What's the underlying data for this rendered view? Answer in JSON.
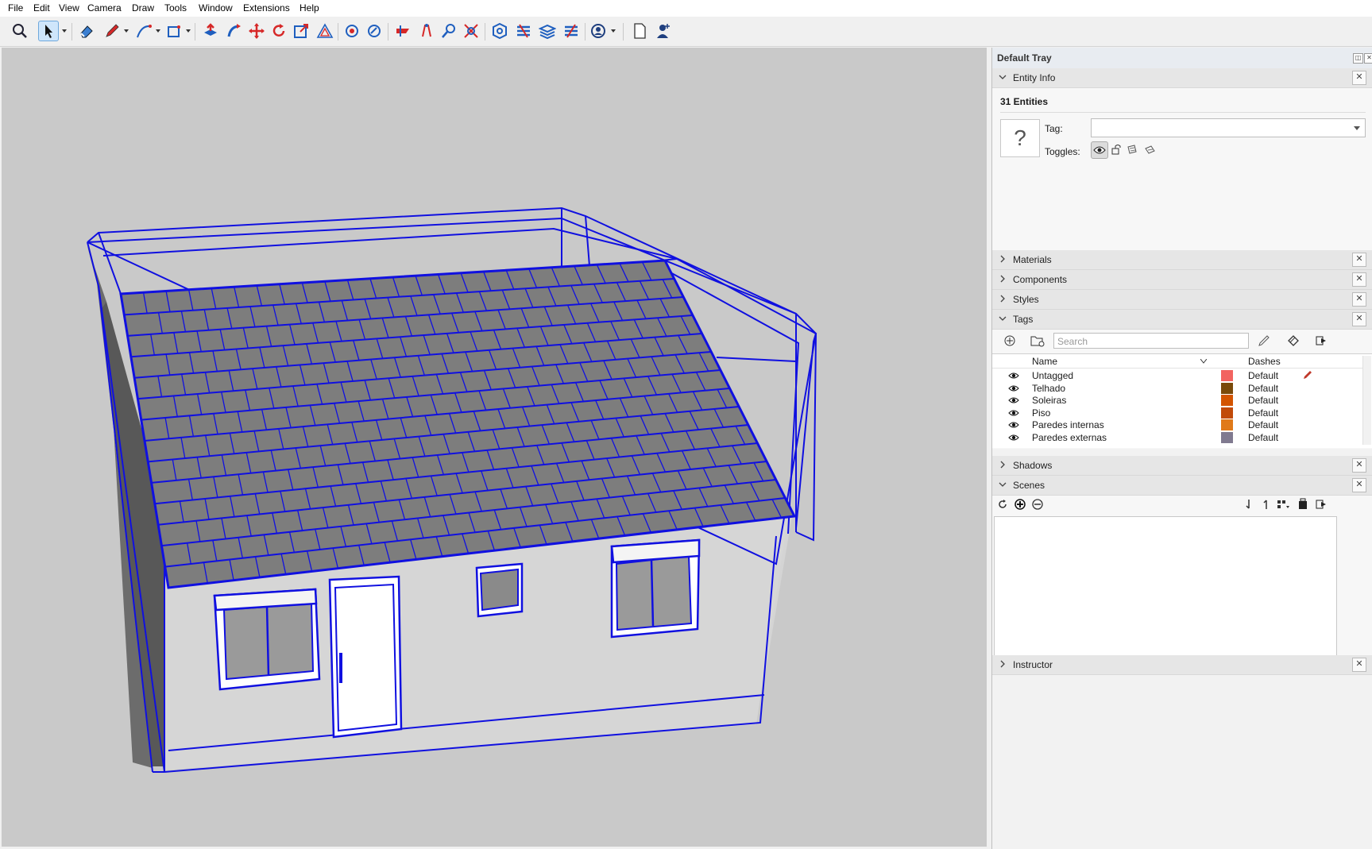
{
  "menu": [
    "File",
    "Edit",
    "View",
    "Camera",
    "Draw",
    "Tools",
    "Window",
    "Extensions",
    "Help"
  ],
  "toolbar_icons": [
    "zoom-icon",
    "select-icon",
    "eraser-icon",
    "pencil-icon",
    "line-icon",
    "rectangle-icon",
    "push-pull-icon",
    "follow-me-icon",
    "move-icon",
    "rotate-icon",
    "scale-icon",
    "offset-icon",
    "orbit-icon",
    "pan-icon",
    "section-icon",
    "walk-icon",
    "look-around-icon",
    "zoom-extents-icon",
    "warehouse-icon",
    "extension-warehouse-icon",
    "layers-icon",
    "solid-tools-icon",
    "account-icon",
    "new-file-icon",
    "user-icon"
  ],
  "tray": {
    "title": "Default Tray",
    "entity_info": {
      "label": "Entity Info",
      "count": "31 Entities",
      "tag_label": "Tag:",
      "tag_value": "",
      "toggles_label": "Toggles:",
      "placeholder_icon": "?"
    },
    "materials": "Materials",
    "components": "Components",
    "styles": "Styles",
    "tags": {
      "label": "Tags",
      "search_placeholder": "Search",
      "col_name": "Name",
      "col_dashes": "Dashes",
      "rows": [
        {
          "name": "Untagged",
          "color": "#f26460",
          "dashes": "Default"
        },
        {
          "name": "Telhado",
          "color": "#7a4a0a",
          "dashes": "Default"
        },
        {
          "name": "Soleiras",
          "color": "#d35400",
          "dashes": "Default"
        },
        {
          "name": "Piso",
          "color": "#c14a08",
          "dashes": "Default"
        },
        {
          "name": "Paredes internas",
          "color": "#e07a1a",
          "dashes": "Default"
        },
        {
          "name": "Paredes externas",
          "color": "#807a90",
          "dashes": "Default"
        }
      ]
    },
    "shadows": "Shadows",
    "scenes": "Scenes",
    "instructor": "Instructor"
  },
  "colors": {
    "selection": "#1010e0",
    "viewport_bg": "#c9c9c9",
    "wall": "#d2d2d2",
    "roof_tile": "#7a7a7a"
  }
}
